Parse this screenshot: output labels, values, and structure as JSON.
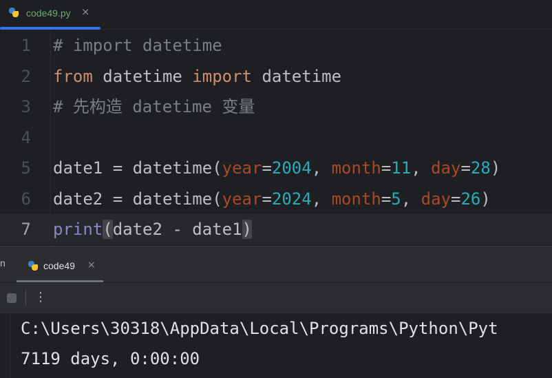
{
  "editor_tab": {
    "filename": "code49.py",
    "close_glyph": "×",
    "icon": "python-file-icon"
  },
  "lines": [
    {
      "n": "1",
      "tokens": [
        {
          "t": "# import datetime",
          "c": "cm"
        }
      ]
    },
    {
      "n": "2",
      "tokens": [
        {
          "t": "from",
          "c": "kw"
        },
        {
          "t": " datetime "
        },
        {
          "t": "import",
          "c": "kw"
        },
        {
          "t": " datetime"
        }
      ]
    },
    {
      "n": "3",
      "tokens": [
        {
          "t": "# 先构造 datetime 变量",
          "c": "cm"
        }
      ]
    },
    {
      "n": "4",
      "tokens": []
    },
    {
      "n": "5",
      "tokens": [
        {
          "t": "date1 = datetime("
        },
        {
          "t": "year",
          "c": "param"
        },
        {
          "t": "="
        },
        {
          "t": "2004",
          "c": "num"
        },
        {
          "t": ", "
        },
        {
          "t": "month",
          "c": "param"
        },
        {
          "t": "="
        },
        {
          "t": "11",
          "c": "num"
        },
        {
          "t": ", "
        },
        {
          "t": "day",
          "c": "param"
        },
        {
          "t": "="
        },
        {
          "t": "28",
          "c": "num"
        },
        {
          "t": ")"
        }
      ]
    },
    {
      "n": "6",
      "tokens": [
        {
          "t": "date2 = datetime("
        },
        {
          "t": "year",
          "c": "param"
        },
        {
          "t": "="
        },
        {
          "t": "2024",
          "c": "num"
        },
        {
          "t": ", "
        },
        {
          "t": "month",
          "c": "param"
        },
        {
          "t": "="
        },
        {
          "t": "5",
          "c": "num"
        },
        {
          "t": ", "
        },
        {
          "t": "day",
          "c": "param"
        },
        {
          "t": "="
        },
        {
          "t": "26",
          "c": "num"
        },
        {
          "t": ")"
        }
      ]
    },
    {
      "n": "7",
      "current": true,
      "tokens": [
        {
          "t": "print",
          "c": "builtin"
        },
        {
          "t": "(",
          "c": "br"
        },
        {
          "t": "date2 - date1"
        },
        {
          "t": ")",
          "c": "br"
        }
      ]
    }
  ],
  "run_panel": {
    "clipped_label": "n",
    "tab_label": "code49",
    "close_glyph": "×",
    "more_glyph": "⋮",
    "output": [
      "C:\\Users\\30318\\AppData\\Local\\Programs\\Python\\Pyt",
      "7119 days, 0:00:00"
    ]
  },
  "colors": {
    "background": "#1e1f22",
    "accent": "#3574f0",
    "keyword": "#cf8e6d",
    "number": "#2aacb8",
    "parameter": "#aa4926",
    "comment": "#7a7e85",
    "builtin": "#8888c6",
    "text": "#bcbec4",
    "tab_filename": "#6aab73"
  }
}
